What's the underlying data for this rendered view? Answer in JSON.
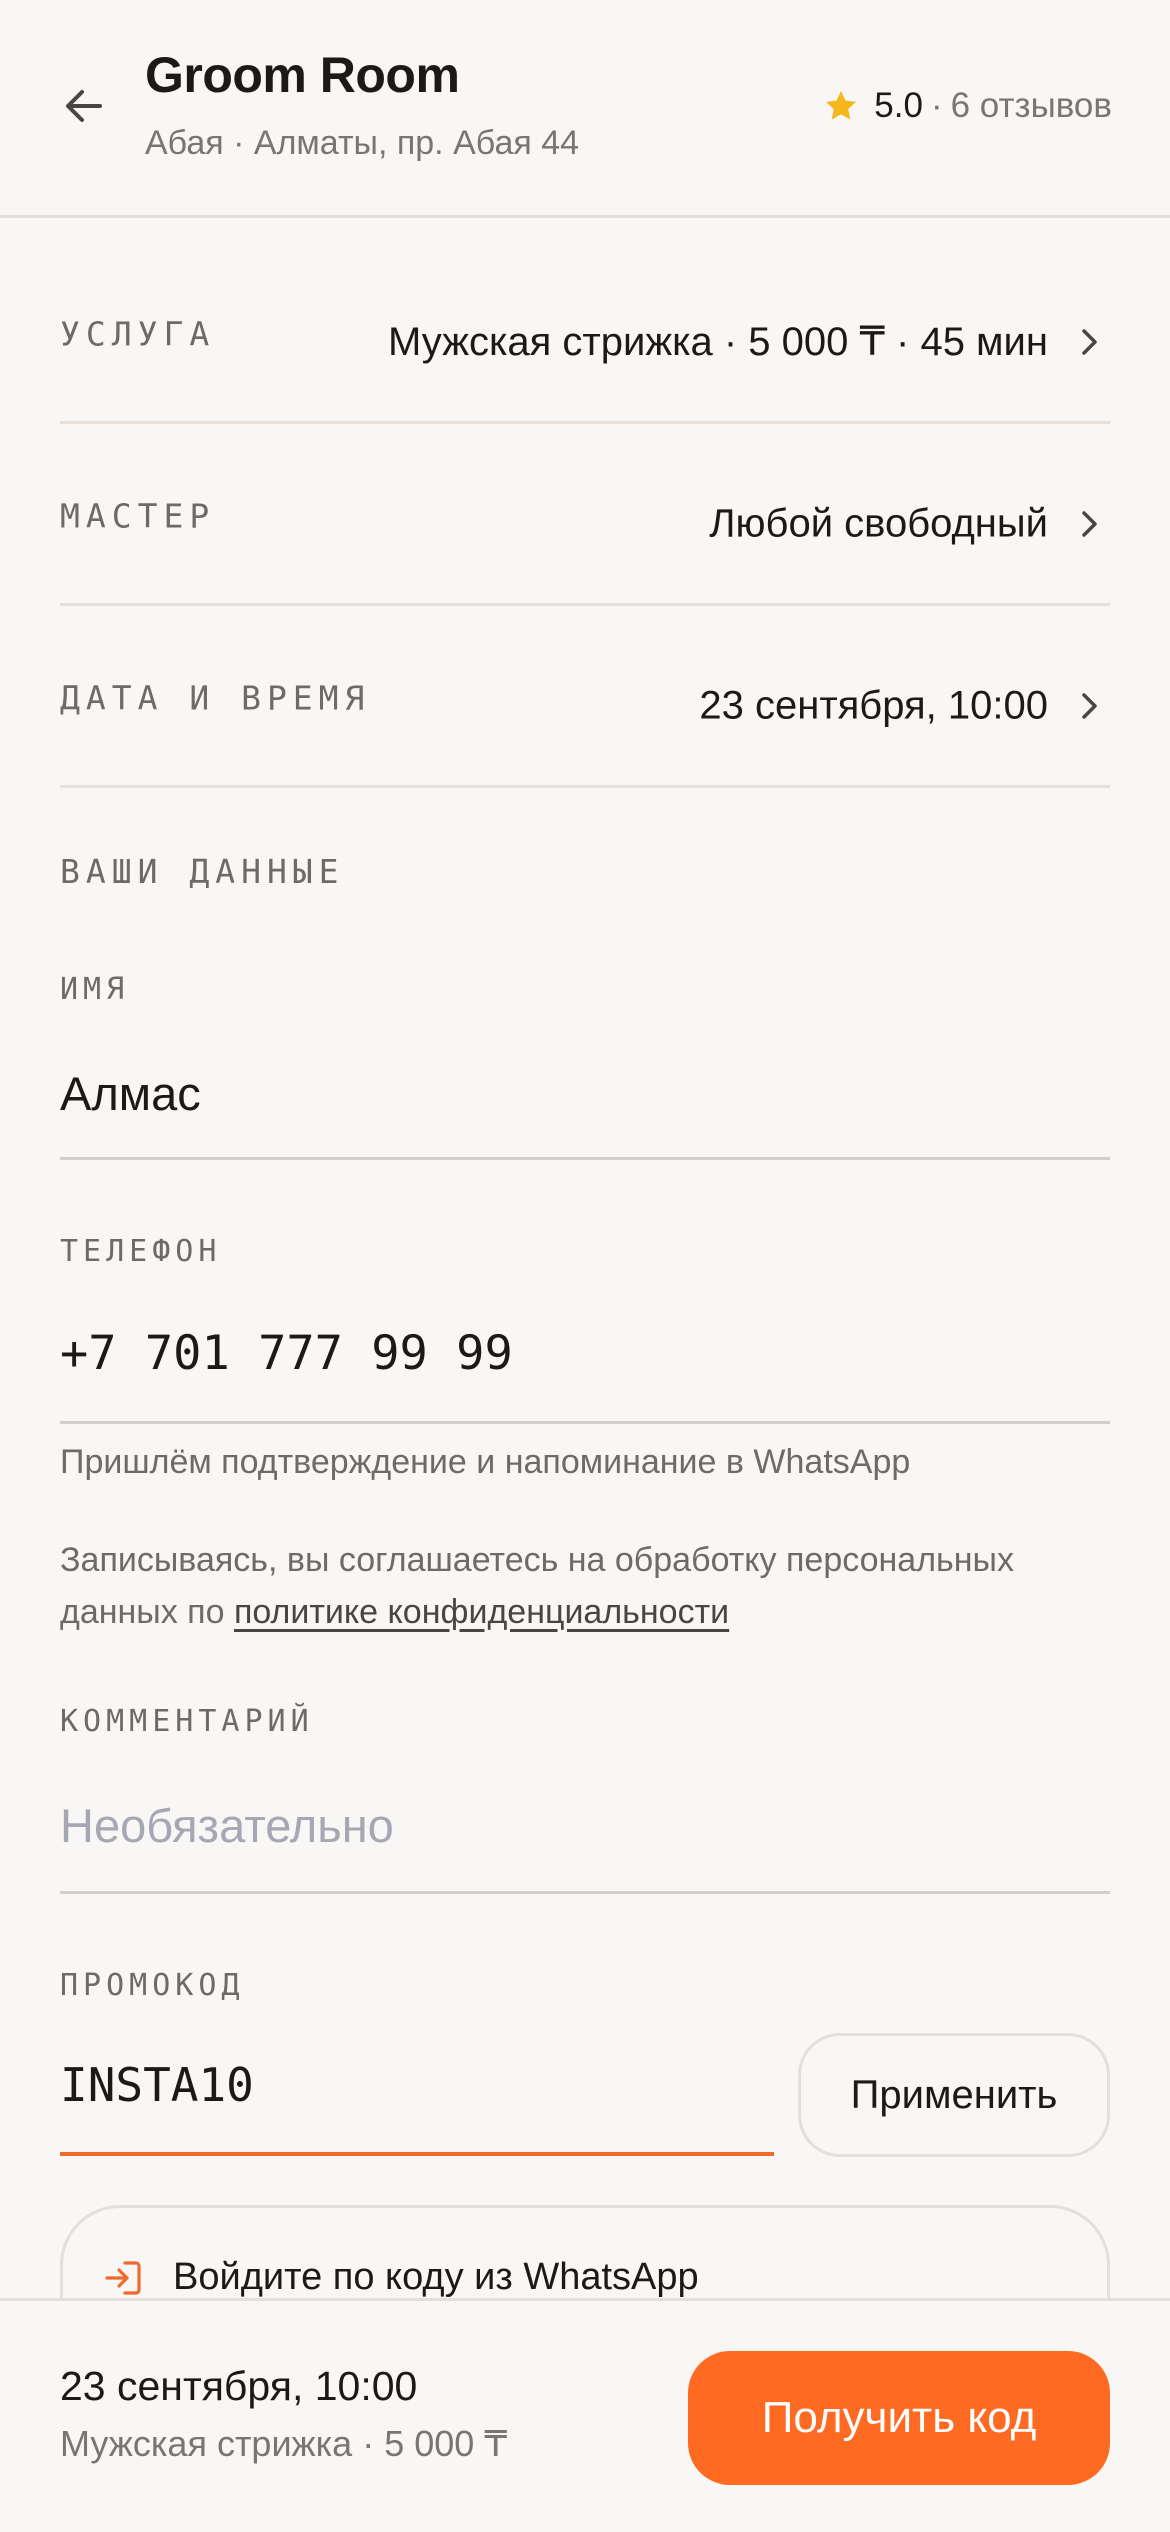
{
  "header": {
    "title": "Groom Room",
    "subtitle": "Абая · Алматы, пр. Абая 44",
    "rating": "5.0",
    "rating_sep": "·",
    "reviews": "6 отзывов"
  },
  "rows": [
    {
      "label": "УСЛУГА",
      "value": "Мужская стрижка · 5 000 ₸ · 45 мин"
    },
    {
      "label": "МАСТЕР",
      "value": "Любой свободный"
    },
    {
      "label": "ДАТА И ВРЕМЯ",
      "value": "23 сентября, 10:00"
    }
  ],
  "form": {
    "section_title": "ВАШИ ДАННЫЕ",
    "name_label": "ИМЯ",
    "name_value": "Алмас",
    "phone_label": "ТЕЛЕФОН",
    "phone_value": "+7 701 777 99 99",
    "phone_hint": "Пришлём подтверждение и напоминание в WhatsApp",
    "consent_text": "Записываясь, вы соглашаетесь на обработку персональных данных по ",
    "consent_link": "политике конфиденциальности",
    "comment_label": "КОММЕНТАРИЙ",
    "comment_placeholder": "Необязательно",
    "promo_label": "ПРОМОКОД",
    "promo_value": "INSTA10",
    "apply_label": "Применить"
  },
  "whatsapp_login": {
    "label": "Войдите по коду из WhatsApp"
  },
  "summary": {
    "datetime": "23 сентября, 10:00",
    "service": "Мужская стрижка · 5 000 ₸",
    "cta_label": "Получить код"
  },
  "colors": {
    "accent": "#ff6a22",
    "star": "#f5b81c",
    "background": "#f9f7f5"
  },
  "icons": {
    "back": "arrow-left-icon",
    "rating": "star-icon",
    "chevron": "chevron-right-icon",
    "login": "login-icon"
  }
}
